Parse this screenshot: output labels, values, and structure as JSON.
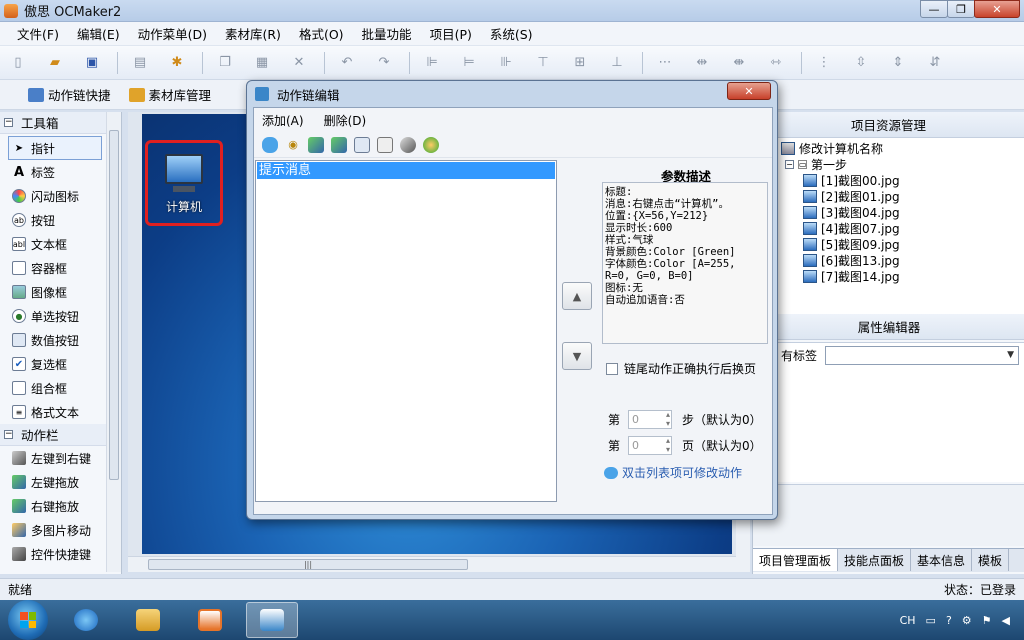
{
  "window": {
    "title": "傲思 OCMaker2",
    "min": "—",
    "max": "❐",
    "close": "✕"
  },
  "menu": [
    "文件(F)",
    "编辑(E)",
    "动作菜单(D)",
    "素材库(R)",
    "格式(O)",
    "批量功能",
    "项目(P)",
    "系统(S)"
  ],
  "toolbar2": {
    "action_chain": "动作链快捷",
    "asset_mgmt": "素材库管理"
  },
  "toolbox": {
    "section1": "工具箱",
    "tools": [
      "指针",
      "标签",
      "闪动图标",
      "按钮",
      "文本框",
      "容器框",
      "图像框",
      "单选按钮",
      "数值按钮",
      "复选框",
      "组合框",
      "格式文本"
    ],
    "section2": "动作栏",
    "actions": [
      "左键到右键",
      "左键拖放",
      "右键拖放",
      "多图片移动",
      "控件快捷键"
    ]
  },
  "canvas": {
    "icon_label": "计算机"
  },
  "project_panel": {
    "title": "项目资源管理",
    "root": "修改计算机名称",
    "step": "第一步",
    "files": [
      "[1]截图00.jpg",
      "[2]截图01.jpg",
      "[3]截图04.jpg",
      "[4]截图07.jpg",
      "[5]截图09.jpg",
      "[6]截图13.jpg",
      "[7]截图14.jpg"
    ]
  },
  "property_panel": {
    "title": "属性编辑器",
    "row_label": "有标签"
  },
  "right_tabs": [
    "项目管理面板",
    "技能点面板",
    "基本信息",
    "模板"
  ],
  "status": {
    "left": "就绪",
    "right": "状态：已登录"
  },
  "tray": {
    "lang": "CH"
  },
  "dialog": {
    "title": "动作链编辑",
    "menu_add": "添加(A)",
    "menu_delete": "删除(D)",
    "list_item": "提示消息",
    "param_title": "参数描述",
    "param_text": "标题:\n消息:右键点击“计算机”。\n位置:{X=56,Y=212}\n显示时长:600\n样式:气球\n背景颜色:Color [Green]\n字体颜色:Color [A=255, R=0, G=0, B=0]\n图标:无\n自动追加语音:否",
    "checkbox": "链尾动作正确执行后换页",
    "step_prefix": "第",
    "step_value": "0",
    "step_suffix": "步（默认为0）",
    "page_prefix": "第",
    "page_value": "0",
    "page_suffix": "页（默认为0）",
    "hint": "双击列表项可修改动作"
  },
  "colors": {
    "accent": "#3399ff",
    "close_red": "#c7402a",
    "desktop_blue": "#1b64b5",
    "highlight_red": "#e02020"
  }
}
